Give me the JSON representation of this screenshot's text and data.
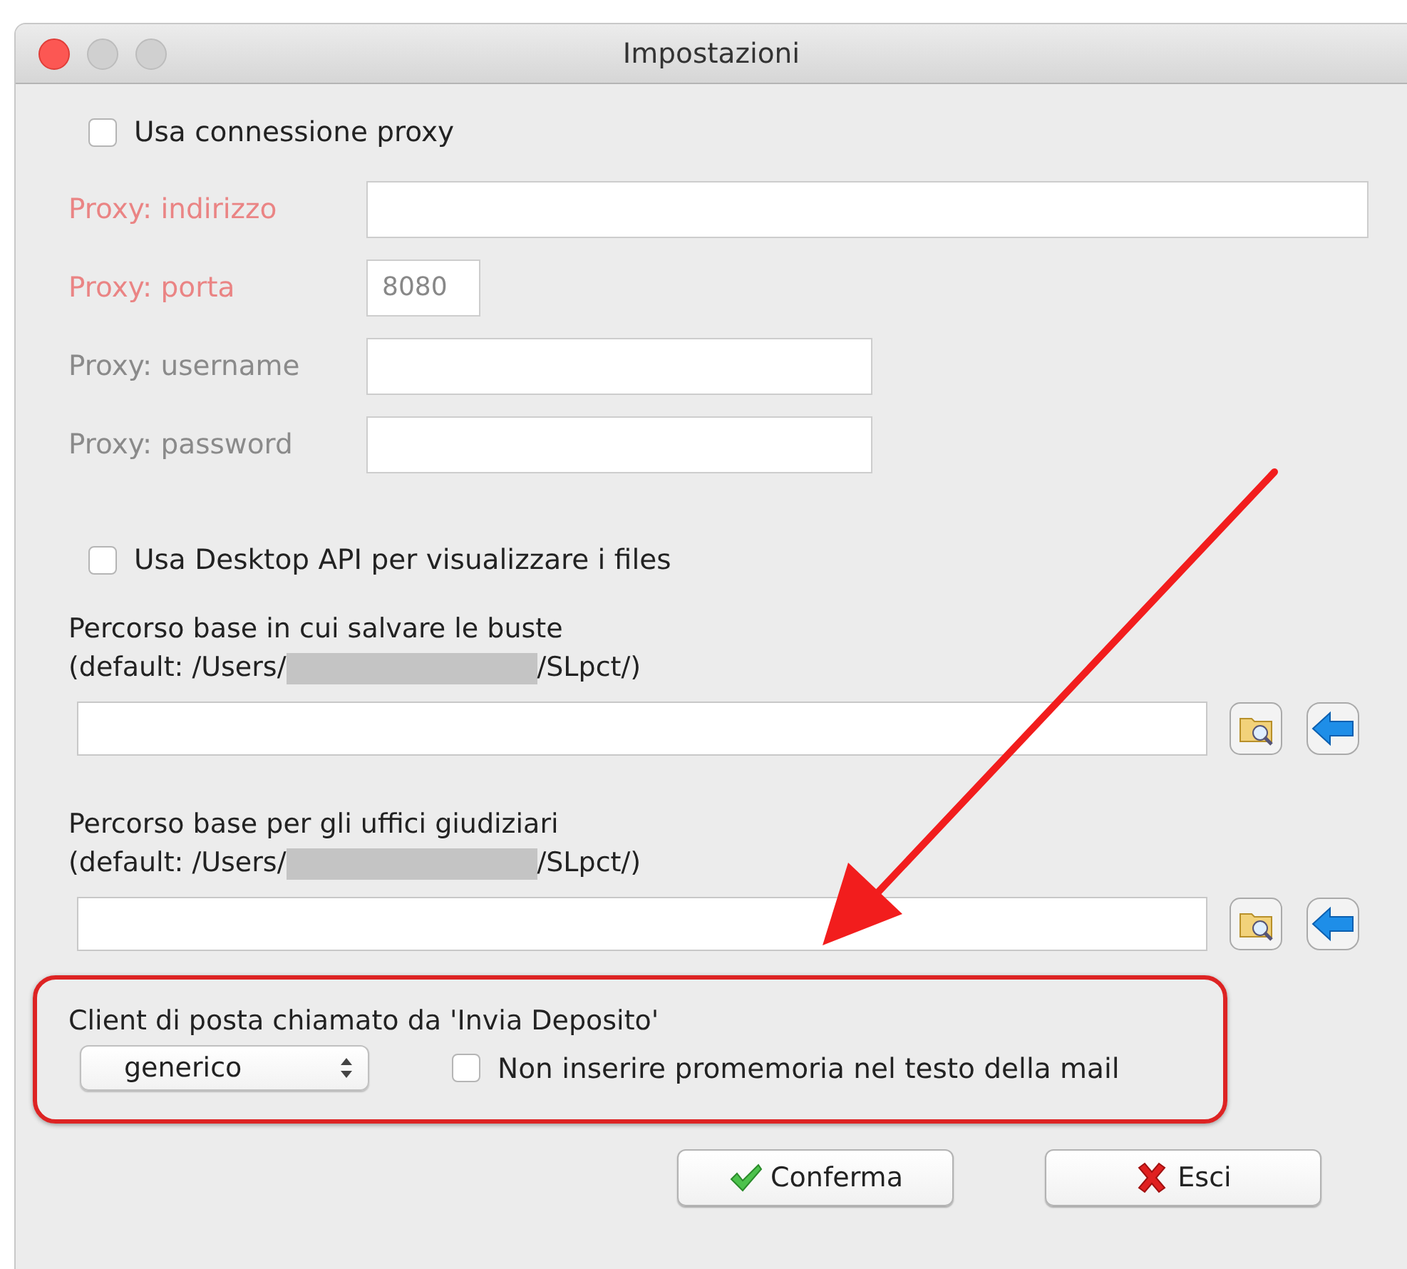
{
  "window": {
    "title": "Impostazioni"
  },
  "use_proxy": {
    "label": "Usa connessione proxy",
    "checked": false
  },
  "proxy_fields": [
    {
      "label": "Proxy: indirizzo",
      "kind": "required"
    },
    {
      "label": "Proxy: porta",
      "kind": "required",
      "value": "8080"
    },
    {
      "label": "Proxy: username",
      "kind": "optional"
    },
    {
      "label": "Proxy: password",
      "kind": "optional"
    }
  ],
  "use_desktop_api": {
    "label": "Usa Desktop API per visualizzare i files",
    "checked": false
  },
  "paths": [
    {
      "label": "Percorso base in cui salvare le buste",
      "default_prefix": "(default: /Users/",
      "default_suffix": "/SLpct/)"
    },
    {
      "label": "Percorso base per gli uffici giudiziari",
      "default_prefix": "(default: /Users/",
      "default_suffix": "/SLpct/)"
    }
  ],
  "mail_client": {
    "label": "Client di posta chiamato da 'Invia Deposito'",
    "selected_option": "generico",
    "no_reminder": {
      "label": "Non inserire promemoria nel testo della mail",
      "checked": false
    }
  },
  "buttons": [
    {
      "label": "Conferma",
      "kind": "confirm"
    },
    {
      "label": "Esci",
      "kind": "exit"
    }
  ]
}
